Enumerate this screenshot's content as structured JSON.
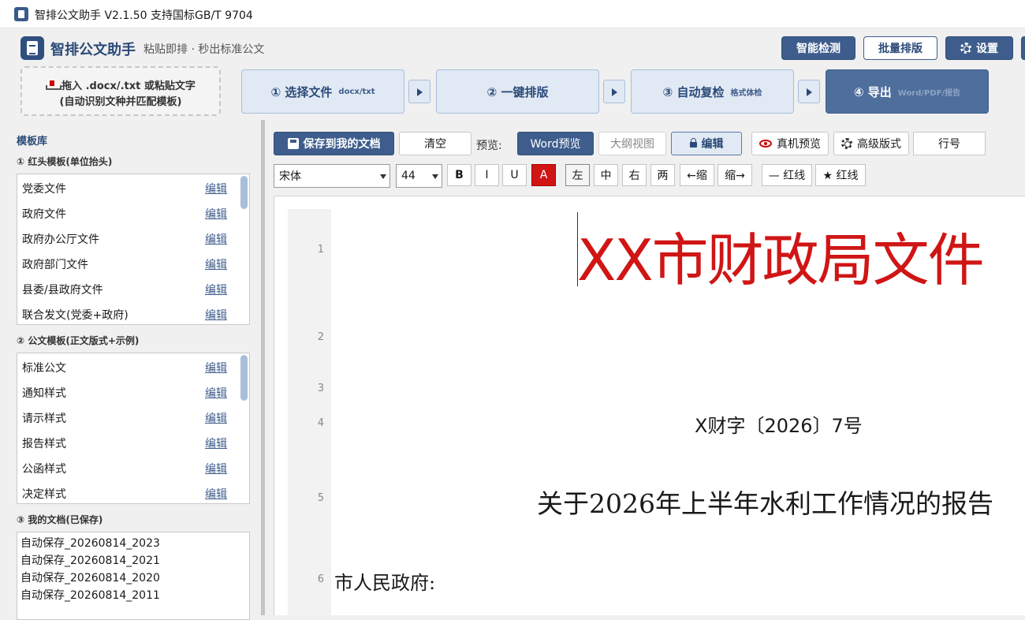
{
  "window": {
    "title": "智排公文助手 V2.1.50 支持国标GB/T 9704"
  },
  "brand": {
    "name": "智排公文助手",
    "subtitle": "粘贴即排 · 秒出标准公文"
  },
  "header_buttons": {
    "smart_check": "智能检测",
    "batch": "批量排版",
    "settings": "设置"
  },
  "dropzone": {
    "line1": "拖入 .docx/.txt 或粘贴文字",
    "line2": "(自动识别文种并匹配模板)"
  },
  "steps": [
    {
      "label": "① 选择文件",
      "hint": "docx/txt"
    },
    {
      "label": "② 一键排版",
      "hint": ""
    },
    {
      "label": "③ 自动复检",
      "hint": "格式体检"
    },
    {
      "label": "④ 导出",
      "hint": "Word/PDF/报告"
    }
  ],
  "library": {
    "title": "模板库",
    "section1": {
      "title": "① 红头模板(单位抬头)",
      "items": [
        "党委文件",
        "政府文件",
        "政府办公厅文件",
        "政府部门文件",
        "县委/县政府文件",
        "联合发文(党委+政府)"
      ]
    },
    "section2": {
      "title": "② 公文模板(正文版式+示例)",
      "items": [
        "标准公文",
        "通知样式",
        "请示样式",
        "报告样式",
        "公函样式",
        "决定样式"
      ]
    },
    "section3": {
      "title": "③ 我的文档(已保存)",
      "items": [
        "自动保存_20260814_2023",
        "自动保存_20260814_2021",
        "自动保存_20260814_2020",
        "自动保存_20260814_2011"
      ]
    },
    "edit_label": "编辑"
  },
  "toolbar": {
    "save": "保存到我的文档",
    "clear": "清空",
    "preview_label": "预览:",
    "word_preview": "Word预览",
    "outline_view": "大纲视图",
    "edit": "编辑",
    "device_preview": "真机预览",
    "advanced": "高级版式",
    "line_no": "行号"
  },
  "format": {
    "font": "宋体",
    "size": "44",
    "bold": "B",
    "italic": "I",
    "underline": "U",
    "color": "A",
    "left": "左",
    "center": "中",
    "right": "右",
    "justify": "两",
    "outdent": "←缩",
    "indent": "缩→",
    "rule_line": "— 红线",
    "star_line": "★ 红线"
  },
  "document": {
    "line_numbers": [
      "1",
      "2",
      "3",
      "4",
      "5",
      "6"
    ],
    "header": "XX市财政局文件",
    "doc_number": "X财字〔2026〕7号",
    "title": "关于2026年上半年水利工作情况的报告",
    "salutation": "市人民政府:"
  },
  "colors": {
    "accent": "#3e5d8c",
    "red_header": "#d01515",
    "step_bg": "#e1e9f4"
  }
}
